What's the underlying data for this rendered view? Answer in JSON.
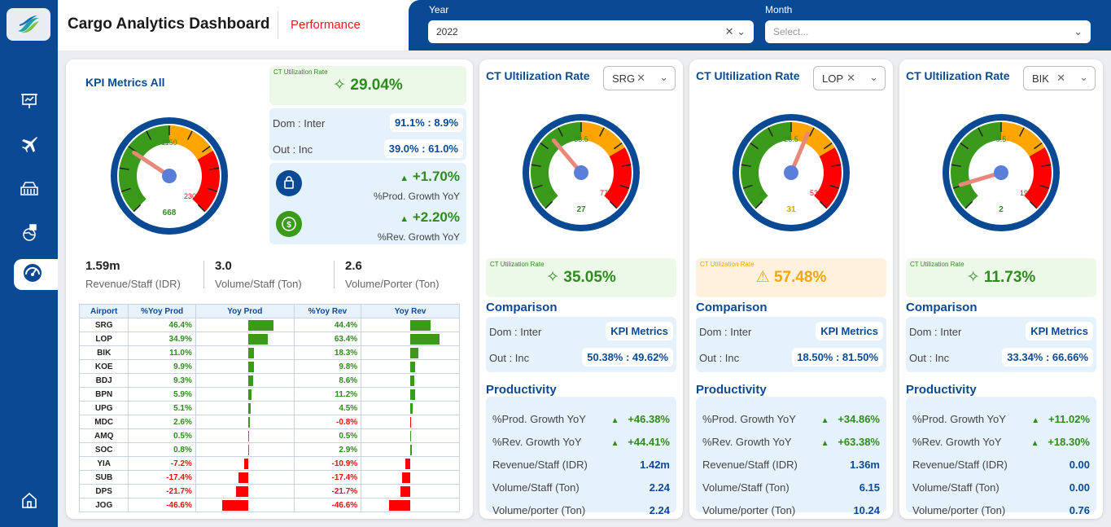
{
  "header": {
    "title": "Cargo Analytics Dashboard",
    "subtitle": "Performance"
  },
  "filters": {
    "year_label": "Year",
    "year_value": "2022",
    "month_label": "Month",
    "month_placeholder": "Select..."
  },
  "colors": {
    "brand": "#0a4a94",
    "green": "#2e8b1e",
    "red": "#e01010",
    "orange": "#f5a800"
  },
  "kpi": {
    "title": "KPI Metrics All",
    "gauge": {
      "min": "0",
      "max": "2300",
      "mid": "1150",
      "value": "668",
      "value_num": 668,
      "max_num": 2300
    },
    "util_label": "CT Utilization Rate",
    "util_value": "29.04%",
    "dom_label": "Dom : Inter",
    "dom_value": "91.1% : 8.9%",
    "out_label": "Out : Inc",
    "out_value": "39.0% : 61.0%",
    "prod_growth_value": "+1.70%",
    "prod_growth_label": "%Prod. Growth YoY",
    "rev_growth_value": "+2.20%",
    "rev_growth_label": "%Rev. Growth YoY",
    "stats": [
      {
        "value": "1.59m",
        "label": "Revenue/Staff (IDR)"
      },
      {
        "value": "3.0",
        "label": "Volume/Staff (Ton)"
      },
      {
        "value": "2.6",
        "label": "Volume/Porter (Ton)"
      }
    ],
    "table": {
      "headers": [
        "Airport",
        "%Yoy Prod",
        "Yoy Prod",
        "%Yoy Rev",
        "Yoy Rev"
      ],
      "rows": [
        {
          "airport": "SRG",
          "prod": "46.4%",
          "prod_num": 46.4,
          "rev": "44.4%",
          "rev_num": 44.4
        },
        {
          "airport": "LOP",
          "prod": "34.9%",
          "prod_num": 34.9,
          "rev": "63.4%",
          "rev_num": 63.4
        },
        {
          "airport": "BIK",
          "prod": "11.0%",
          "prod_num": 11.0,
          "rev": "18.3%",
          "rev_num": 18.3
        },
        {
          "airport": "KOE",
          "prod": "9.9%",
          "prod_num": 9.9,
          "rev": "9.8%",
          "rev_num": 9.8
        },
        {
          "airport": "BDJ",
          "prod": "9.3%",
          "prod_num": 9.3,
          "rev": "8.6%",
          "rev_num": 8.6
        },
        {
          "airport": "BPN",
          "prod": "5.9%",
          "prod_num": 5.9,
          "rev": "11.2%",
          "rev_num": 11.2
        },
        {
          "airport": "UPG",
          "prod": "5.1%",
          "prod_num": 5.1,
          "rev": "4.5%",
          "rev_num": 4.5
        },
        {
          "airport": "MDC",
          "prod": "2.6%",
          "prod_num": 2.6,
          "rev": "-0.8%",
          "rev_num": -0.8
        },
        {
          "airport": "AMQ",
          "prod": "0.5%",
          "prod_num": 0.5,
          "rev": "0.5%",
          "rev_num": 0.5
        },
        {
          "airport": "SOC",
          "prod": "0.8%",
          "prod_num": 0.8,
          "rev": "2.9%",
          "rev_num": 2.9
        },
        {
          "airport": "YIA",
          "prod": "-7.2%",
          "prod_num": -7.2,
          "rev": "-10.9%",
          "rev_num": -10.9
        },
        {
          "airport": "SUB",
          "prod": "-17.4%",
          "prod_num": -17.4,
          "rev": "-17.4%",
          "rev_num": -17.4
        },
        {
          "airport": "DPS",
          "prod": "-21.7%",
          "prod_num": -21.7,
          "rev": "-21.7%",
          "rev_num": -21.7
        },
        {
          "airport": "JOG",
          "prod": "-46.6%",
          "prod_num": -46.6,
          "rev": "-46.6%",
          "rev_num": -46.6
        }
      ]
    }
  },
  "airports": [
    {
      "title": "CT Ultilization Rate",
      "code": "SRG",
      "gauge": {
        "min": "0",
        "max": "77",
        "mid": "38.5",
        "value": "27",
        "value_num": 27,
        "max_num": 77
      },
      "util_label": "CT Utilization Rate",
      "util_value": "35.05%",
      "util_status": "good",
      "comparison_title": "Comparison",
      "dom_label": "Dom : Inter",
      "dom_value": "KPI Metrics",
      "out_label": "Out : Inc",
      "out_value": "50.38% : 49.62%",
      "productivity_title": "Productivity",
      "rows": [
        {
          "label": "%Prod. Growth YoY",
          "value": "+46.38%",
          "growth": true
        },
        {
          "label": "%Rev. Growth YoY",
          "value": "+44.41%",
          "growth": true
        },
        {
          "label": "Revenue/Staff (IDR)",
          "value": "1.42m",
          "growth": false
        },
        {
          "label": "Volume/Staff (Ton)",
          "value": "2.24",
          "growth": false
        },
        {
          "label": "Volume/porter (Ton)",
          "value": "2.24",
          "growth": false
        }
      ]
    },
    {
      "title": "CT Ultilization Rate",
      "code": "LOP",
      "gauge": {
        "min": "0",
        "max": "53",
        "mid": "26.5",
        "value": "31",
        "value_num": 31,
        "max_num": 53
      },
      "util_label": "CT Utilization Rate",
      "util_value": "57.48%",
      "util_status": "warning",
      "comparison_title": "Comparison",
      "dom_label": "Dom : Inter",
      "dom_value": "KPI Metrics",
      "out_label": "Out : Inc",
      "out_value": "18.50% : 81.50%",
      "productivity_title": "Productivity",
      "rows": [
        {
          "label": "%Prod. Growth YoY",
          "value": "+34.86%",
          "growth": true
        },
        {
          "label": "%Rev. Growth YoY",
          "value": "+63.38%",
          "growth": true
        },
        {
          "label": "Revenue/Staff (IDR)",
          "value": "1.36m",
          "growth": false
        },
        {
          "label": "Volume/Staff (Ton)",
          "value": "6.15",
          "growth": false
        },
        {
          "label": "Volume/porter (Ton)",
          "value": "10.24",
          "growth": false
        }
      ]
    },
    {
      "title": "CT Ultilization Rate",
      "code": "BIK",
      "gauge": {
        "min": "0",
        "max": "19",
        "mid": "9.5",
        "value": "2",
        "value_num": 2,
        "max_num": 19
      },
      "util_label": "CT Utilization Rate",
      "util_value": "11.73%",
      "util_status": "good",
      "comparison_title": "Comparison",
      "dom_label": "Dom : Inter",
      "dom_value": "KPI Metrics",
      "out_label": "Out : Inc",
      "out_value": "33.34% : 66.66%",
      "productivity_title": "Productivity",
      "rows": [
        {
          "label": "%Prod. Growth YoY",
          "value": "+11.02%",
          "growth": true
        },
        {
          "label": "%Rev. Growth YoY",
          "value": "+18.30%",
          "growth": true
        },
        {
          "label": "Revenue/Staff (IDR)",
          "value": "0.00",
          "growth": false
        },
        {
          "label": "Volume/Staff (Ton)",
          "value": "0.00",
          "growth": false
        },
        {
          "label": "Volume/porter (Ton)",
          "value": "0.76",
          "growth": false
        }
      ]
    }
  ],
  "nav": {
    "items": [
      "presentation-icon",
      "airplane-icon",
      "cargo-basket-icon",
      "globe-package-icon",
      "speedometer-icon",
      "home-icon"
    ]
  }
}
